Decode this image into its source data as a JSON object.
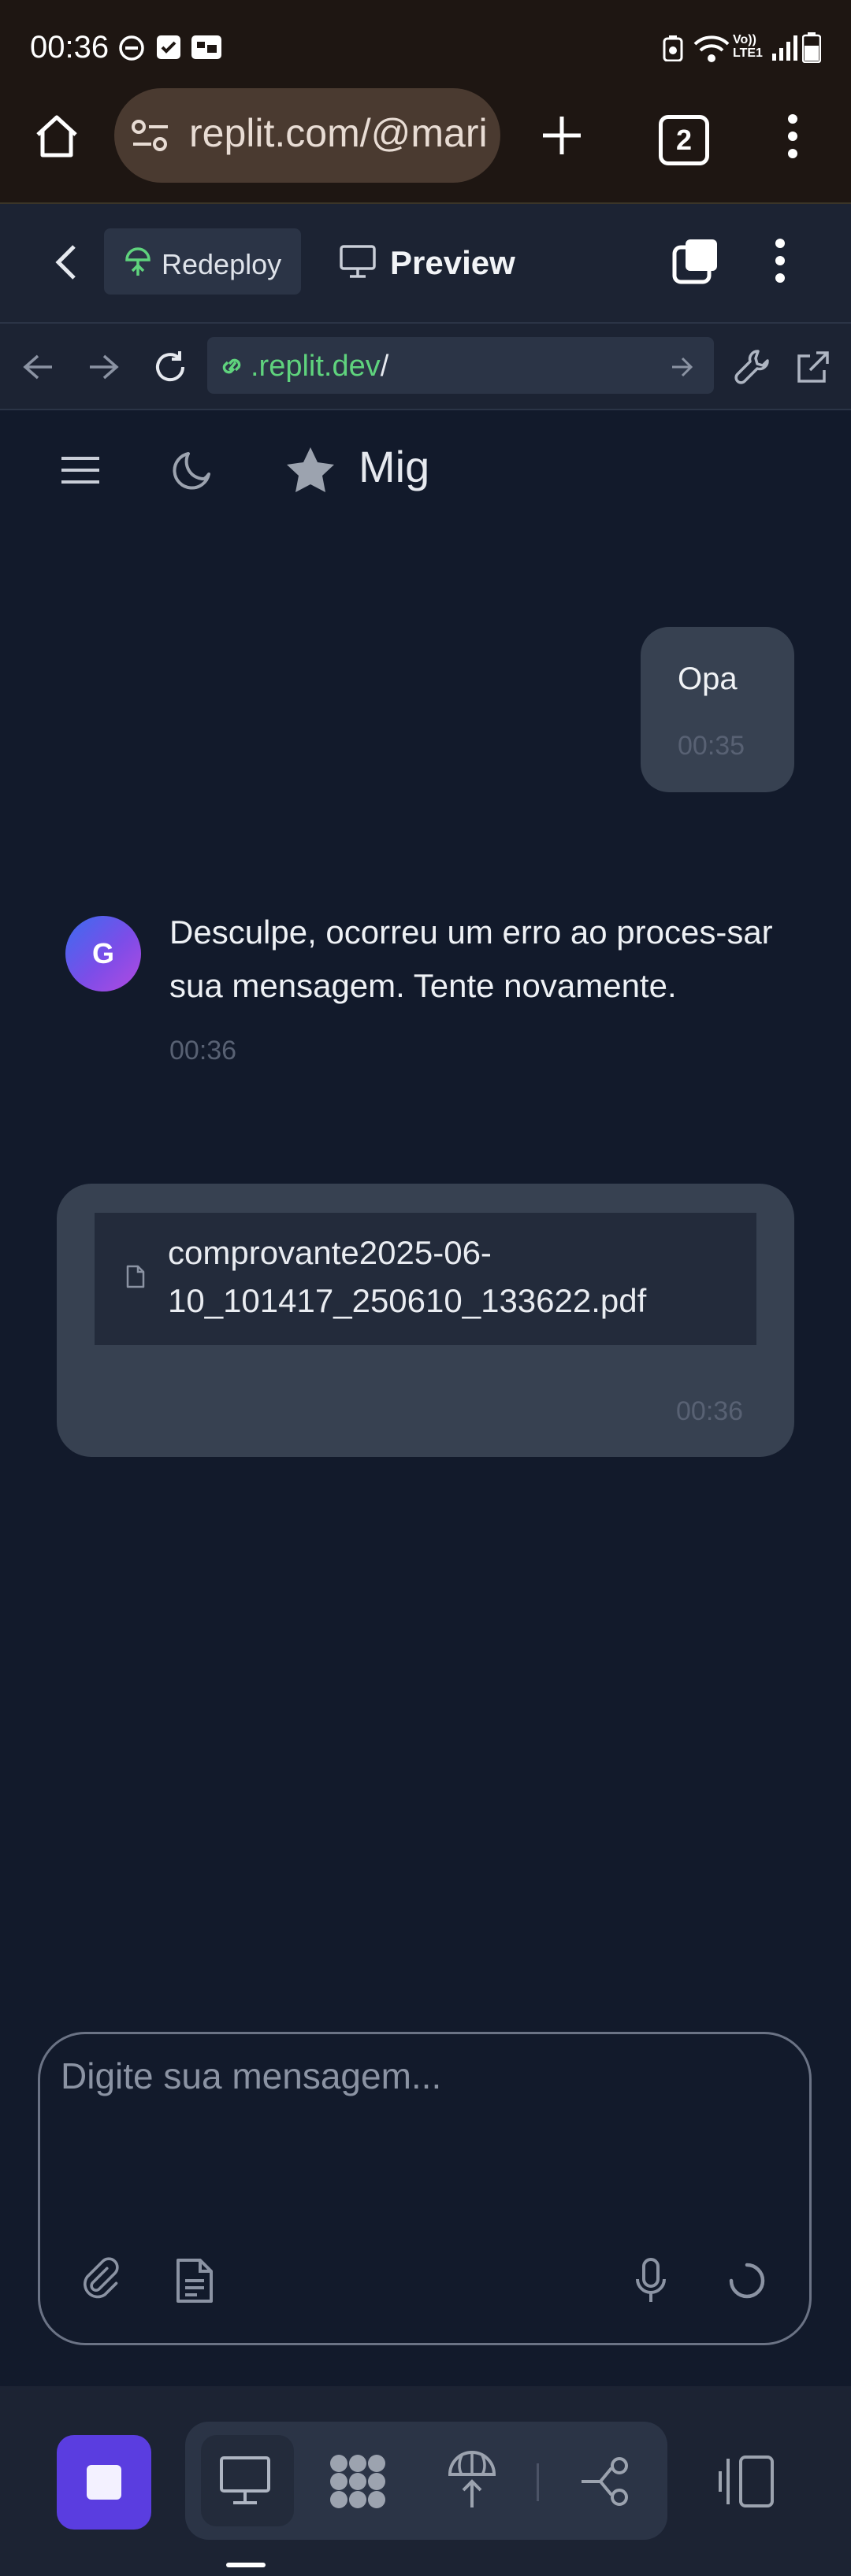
{
  "status_bar": {
    "time": "00:36",
    "icons": [
      "do-not-disturb-icon",
      "checkbox-icon",
      "app-icon",
      "battery-saver-icon",
      "wifi-icon",
      "volte-icon",
      "signal-icon",
      "battery-icon"
    ],
    "volte_label": "Vo)) LTE1"
  },
  "browser": {
    "url": "replit.com/@mari",
    "tab_count": "2"
  },
  "replit_bar": {
    "redeploy_label": "Redeploy",
    "preview_label": "Preview"
  },
  "address_bar": {
    "domain": ".replit.dev",
    "path": "/"
  },
  "app": {
    "title": "Mig"
  },
  "messages": [
    {
      "role": "user",
      "text": "Opa",
      "time": "00:35"
    },
    {
      "role": "assistant",
      "avatar_letter": "G",
      "text": "Desculpe, ocorreu um erro ao proces-sar sua mensagem. Tente novamente.",
      "time": "00:36"
    },
    {
      "role": "user",
      "file_name": "comprovante2025-06-10_101417_250610_133622.pdf",
      "time": "00:36"
    }
  ],
  "composer": {
    "placeholder": "Digite sua mensagem..."
  },
  "colors": {
    "background": "#121a2b",
    "bubble": "#374151",
    "accent": "#5a3de0",
    "link_green": "#5fd37d"
  }
}
